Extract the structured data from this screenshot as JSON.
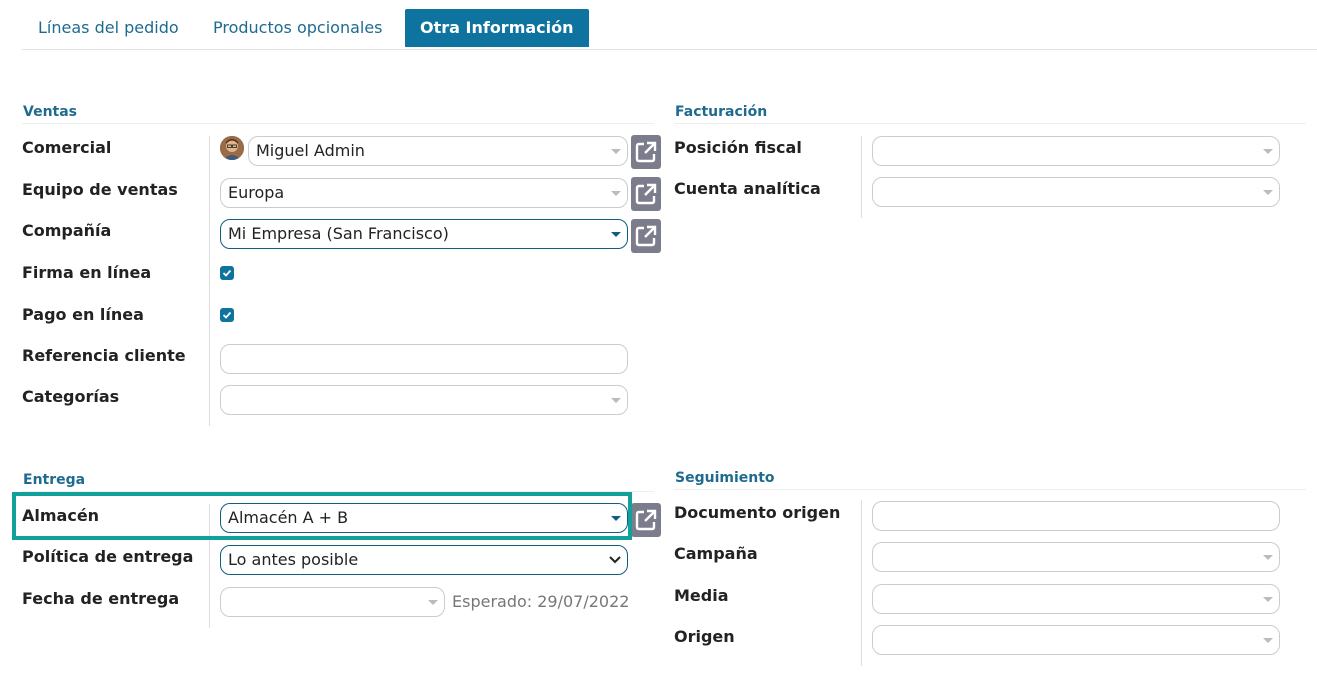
{
  "tabs": [
    "Líneas del pedido",
    "Productos opcionales",
    "Otra Información"
  ],
  "ventas": {
    "title": "Ventas",
    "comercial_label": "Comercial",
    "comercial_value": "Miguel Admin",
    "equipo_label": "Equipo de ventas",
    "equipo_value": "Europa",
    "compania_label": "Compañía",
    "compania_value": "Mi Empresa (San Francisco)",
    "firma_label": "Firma en línea",
    "pago_label": "Pago en línea",
    "referencia_label": "Referencia cliente",
    "categorias_label": "Categorías"
  },
  "facturacion": {
    "title": "Facturación",
    "posicion_label": "Posición fiscal",
    "cuenta_label": "Cuenta analítica"
  },
  "entrega": {
    "title": "Entrega",
    "almacen_label": "Almacén",
    "almacen_value": "Almacén A + B",
    "politica_label": "Política de entrega",
    "politica_value": "Lo antes posible",
    "fecha_label": "Fecha de entrega",
    "fecha_hint": "Esperado: 29/07/2022"
  },
  "seguimiento": {
    "title": "Seguimiento",
    "documento_label": "Documento origen",
    "campana_label": "Campaña",
    "media_label": "Media",
    "origen_label": "Origen"
  },
  "colors": {
    "accent": "#0f73a0",
    "highlight": "#12a19a",
    "external_button": "#7c7d8c"
  }
}
